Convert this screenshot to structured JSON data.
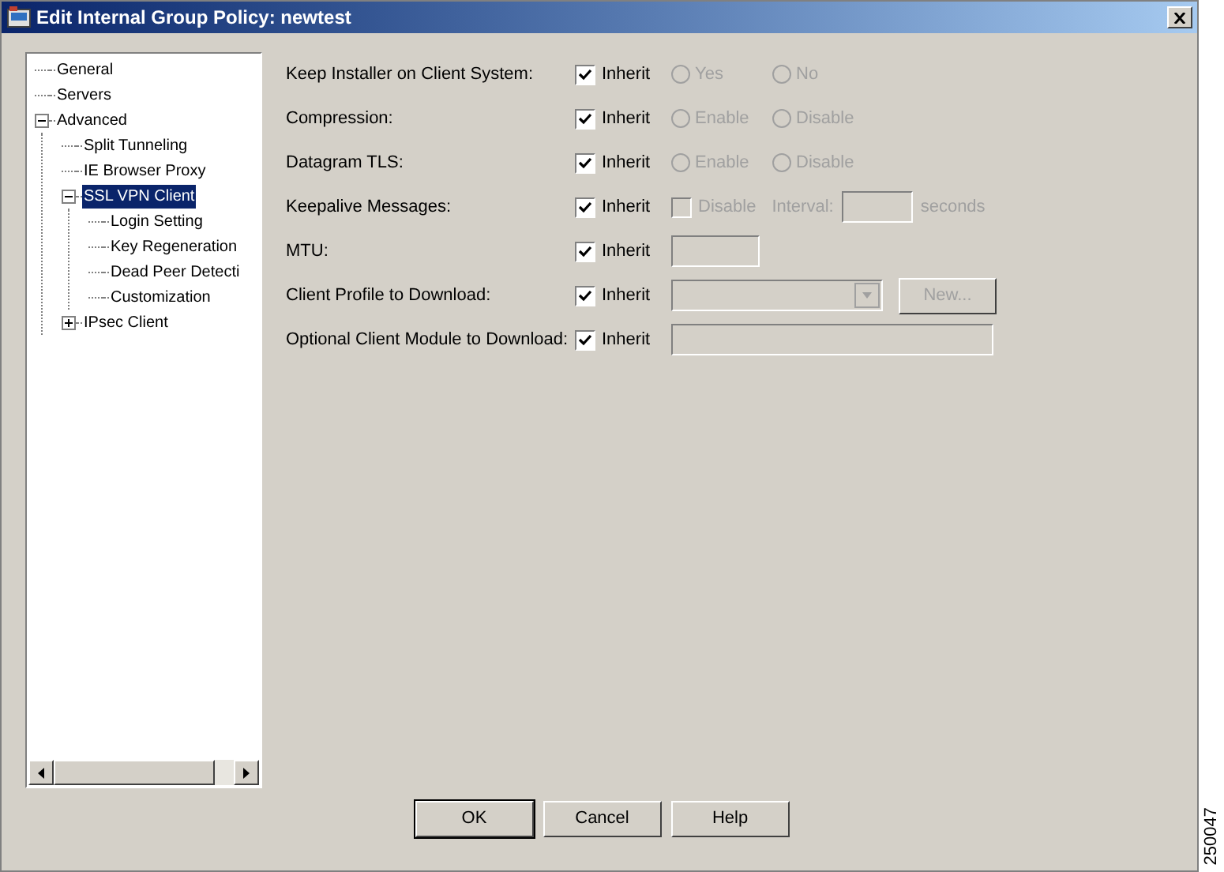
{
  "window": {
    "title": "Edit Internal Group Policy: newtest"
  },
  "tree": [
    {
      "label": "General",
      "selected": false
    },
    {
      "label": "Servers",
      "selected": false
    },
    {
      "label": "Advanced",
      "selected": false,
      "expanded": true,
      "children": [
        {
          "label": "Split Tunneling",
          "selected": false
        },
        {
          "label": "IE Browser Proxy",
          "selected": false
        },
        {
          "label": "SSL VPN Client",
          "selected": true,
          "expanded": true,
          "children": [
            {
              "label": "Login Setting",
              "selected": false
            },
            {
              "label": "Key Regeneration",
              "selected": false
            },
            {
              "label": "Dead Peer Detecti",
              "selected": false
            },
            {
              "label": "Customization",
              "selected": false
            }
          ]
        },
        {
          "label": "IPsec Client",
          "selected": false,
          "expanded": false
        }
      ]
    }
  ],
  "rows": [
    {
      "label": "Keep Installer on Client System:",
      "inherit": {
        "label": "Inherit",
        "checked": true
      },
      "kind": "radios",
      "disabled": true,
      "options": [
        {
          "label": "Yes",
          "selected": false
        },
        {
          "label": "No",
          "selected": false
        }
      ]
    },
    {
      "label": "Compression:",
      "inherit": {
        "label": "Inherit",
        "checked": true
      },
      "kind": "radios",
      "disabled": true,
      "options": [
        {
          "label": "Enable",
          "selected": false
        },
        {
          "label": "Disable",
          "selected": false
        }
      ]
    },
    {
      "label": "Datagram TLS:",
      "inherit": {
        "label": "Inherit",
        "checked": true
      },
      "kind": "radios",
      "disabled": true,
      "options": [
        {
          "label": "Enable",
          "selected": false
        },
        {
          "label": "Disable",
          "selected": false
        }
      ]
    },
    {
      "label": "Keepalive Messages:",
      "inherit": {
        "label": "Inherit",
        "checked": true
      },
      "kind": "keepalive",
      "disabled": true,
      "checkbox": {
        "label": "Disable",
        "checked": false
      },
      "interval_label": "Interval:",
      "unit": "seconds"
    },
    {
      "label": "MTU:",
      "inherit": {
        "label": "Inherit",
        "checked": true
      },
      "kind": "field",
      "disabled": true
    },
    {
      "label": "Client Profile to Download:",
      "inherit": {
        "label": "Inherit",
        "checked": true
      },
      "kind": "combo",
      "disabled": true,
      "button": "New..."
    },
    {
      "label": "Optional Client Module to Download:",
      "inherit": {
        "label": "Inherit",
        "checked": true
      },
      "kind": "wide-field",
      "disabled": true
    }
  ],
  "buttons": [
    "OK",
    "Cancel",
    "Help"
  ],
  "figure_number": "250047"
}
